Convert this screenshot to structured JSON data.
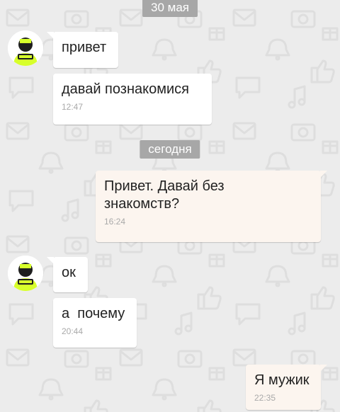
{
  "colors": {
    "wallpaper": "#ececec",
    "date_badge": "#a7a7a7",
    "incoming_bubble": "#ffffff",
    "outgoing_bubble": "#fcf5ef",
    "avatar_accent": "#d7ff2b"
  },
  "chat": {
    "date_separators": [
      "30 мая",
      "сегодня"
    ],
    "messages": [
      {
        "direction": "incoming",
        "text": "привет",
        "time": ""
      },
      {
        "direction": "incoming",
        "text": "давай познакомися",
        "time": "12:47"
      },
      {
        "direction": "outgoing",
        "text": "Привет. Давай без\nзнакомств?",
        "time": "16:24"
      },
      {
        "direction": "incoming",
        "text": "ок",
        "time": ""
      },
      {
        "direction": "incoming",
        "text": "а  почему",
        "time": "20:44"
      },
      {
        "direction": "outgoing",
        "text": "Я мужик",
        "time": "22:35"
      }
    ]
  },
  "icons": [
    "avatar-icon",
    "wallpaper-pattern-icon"
  ]
}
